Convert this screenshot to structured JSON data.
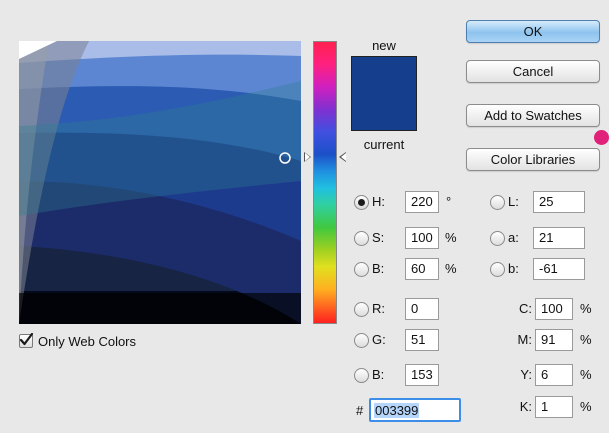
{
  "buttons": {
    "ok": "OK",
    "cancel": "Cancel",
    "add_to_swatches": "Add to Swatches",
    "color_libraries": "Color Libraries"
  },
  "preview": {
    "new_label": "new",
    "current_label": "current",
    "new_color": "#153f8c"
  },
  "only_web_colors": {
    "label": "Only Web Colors",
    "checked": true
  },
  "hsb": {
    "h": {
      "label": "H:",
      "value": "220",
      "unit": "°",
      "selected": true
    },
    "s": {
      "label": "S:",
      "value": "100",
      "unit": "%"
    },
    "b": {
      "label": "B:",
      "value": "60",
      "unit": "%"
    }
  },
  "rgb": {
    "r": {
      "label": "R:",
      "value": "0"
    },
    "g": {
      "label": "G:",
      "value": "51"
    },
    "b": {
      "label": "B:",
      "value": "153"
    }
  },
  "lab": {
    "l": {
      "label": "L:",
      "value": "25"
    },
    "a": {
      "label": "a:",
      "value": "21"
    },
    "b": {
      "label": "b:",
      "value": "-61"
    }
  },
  "cmyk": {
    "c": {
      "label": "C:",
      "value": "100",
      "unit": "%"
    },
    "m": {
      "label": "M:",
      "value": "91",
      "unit": "%"
    },
    "y": {
      "label": "Y:",
      "value": "6",
      "unit": "%"
    },
    "k": {
      "label": "K:",
      "value": "1",
      "unit": "%"
    }
  },
  "hex": {
    "label": "#",
    "value": "003399"
  },
  "colors": {
    "accent": "#e0217a",
    "focus": "#3d8ee8"
  }
}
